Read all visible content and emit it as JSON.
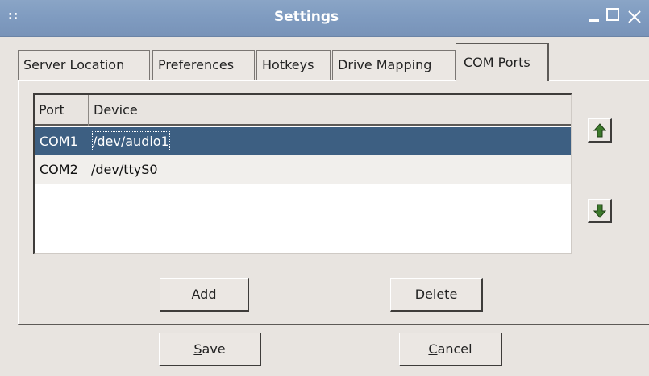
{
  "window": {
    "title": "Settings",
    "grip": "::",
    "controls": {
      "minimize": "_",
      "maximize": "□",
      "close": "✕"
    }
  },
  "tabs": [
    {
      "label": "Server Location",
      "active": false
    },
    {
      "label": "Preferences",
      "active": false
    },
    {
      "label": "Hotkeys",
      "active": false
    },
    {
      "label": "Drive Mapping",
      "active": false
    },
    {
      "label": "COM Ports",
      "active": true
    }
  ],
  "ports_table": {
    "columns": [
      "Port",
      "Device"
    ],
    "rows": [
      {
        "port": "COM1",
        "device": "/dev/audio1",
        "selected": true
      },
      {
        "port": "COM2",
        "device": "/dev/ttyS0",
        "selected": false
      }
    ]
  },
  "icons": {
    "move_up": "arrow-up-icon",
    "move_down": "arrow-down-icon",
    "arrow_color": "#3d7a2b"
  },
  "buttons": {
    "add": {
      "accel": "A",
      "rest": "dd"
    },
    "delete": {
      "accel": "D",
      "rest": "elete"
    },
    "save": {
      "accel": "S",
      "rest": "ave"
    },
    "cancel": {
      "accel": "C",
      "rest": "ancel"
    }
  },
  "colors": {
    "titlebar": "#7f9bc0",
    "selection": "#3d5f82",
    "background": "#e8e4e0"
  }
}
